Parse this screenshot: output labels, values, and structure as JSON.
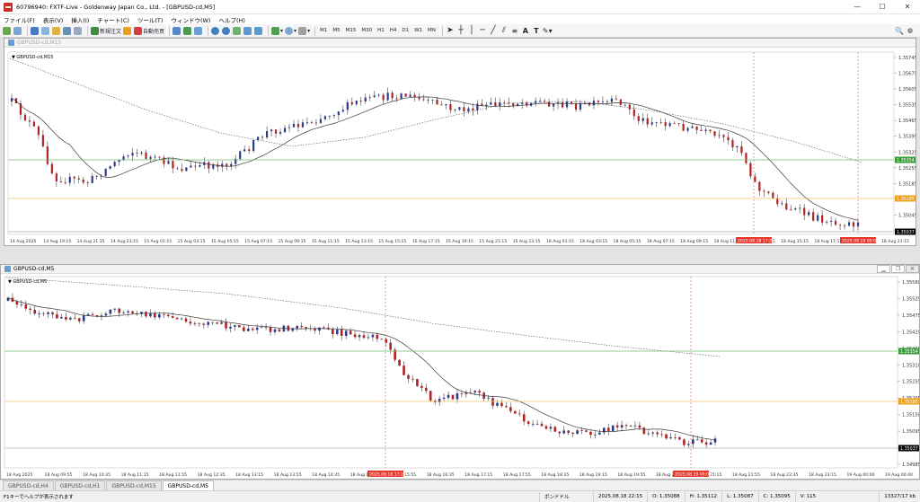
{
  "window": {
    "title": "60796940: FXTF-Live - Goldenway Japan Co., Ltd. - [GBPUSD-cd,M5]",
    "min": "—",
    "max": "☐",
    "close": "✕"
  },
  "menu": [
    "ファイル(F)",
    "表示(V)",
    "挿入(I)",
    "チャート(C)",
    "ツール(T)",
    "ウィンドウ(W)",
    "ヘルプ(H)"
  ],
  "toolbar": {
    "new_order": "新規注文",
    "auto_trade": "自動売買",
    "timeframes": [
      "M1",
      "M5",
      "M15",
      "M30",
      "H1",
      "H4",
      "D1",
      "W1",
      "MN"
    ]
  },
  "charts": {
    "top": {
      "window_title": "GBPUSD-cd,M15",
      "symbol_label": "GBPUSD-cd,M15",
      "price_ticks": [
        "1.35745",
        "1.35675",
        "1.35605",
        "1.35535",
        "1.35465",
        "1.35395",
        "1.35325",
        "1.35255",
        "1.35185",
        "1.35115",
        "1.35045",
        "1.34975"
      ],
      "time_ticks": [
        "14 Aug 2025",
        "14 Aug 19:15",
        "14 Aug 21:15",
        "14 Aug 23:15",
        "15 Aug 01:15",
        "15 Aug 03:15",
        "15 Aug 05:15",
        "15 Aug 07:15",
        "15 Aug 09:15",
        "15 Aug 11:15",
        "15 Aug 13:15",
        "15 Aug 15:15",
        "15 Aug 17:15",
        "15 Aug 19:15",
        "15 Aug 21:15",
        "15 Aug 23:15",
        "18 Aug 01:15",
        "18 Aug 03:15",
        "18 Aug 05:15",
        "18 Aug 07:15",
        "18 Aug 09:15",
        "18 Aug 11:15",
        "18 Aug 13:15",
        "18 Aug 15:15",
        "18 Aug 17:15",
        "18 Aug 19:15",
        "18 Aug 21:15"
      ],
      "hline_green": "1.35354",
      "hline_orange": "1.35185",
      "current_price": "1.35037",
      "vline_labels": [
        "2025.08.18 17:25",
        "2025.08.19 00:05"
      ]
    },
    "bottom": {
      "window_title": "GBPUSD-cd,M5",
      "symbol_label": "GBPUSD-cd,M5",
      "price_ticks": [
        "1.35580",
        "1.35525",
        "1.35475",
        "1.35420",
        "1.35365",
        "1.35310",
        "1.35255",
        "1.35205",
        "1.35150",
        "1.35095",
        "1.35040",
        "1.34985"
      ],
      "time_ticks": [
        "18 Aug 2025",
        "18 Aug 09:55",
        "18 Aug 10:35",
        "18 Aug 11:15",
        "18 Aug 11:55",
        "18 Aug 12:35",
        "18 Aug 13:15",
        "18 Aug 13:55",
        "18 Aug 14:35",
        "18 Aug 15:15",
        "18 Aug 15:55",
        "18 Aug 16:35",
        "18 Aug 17:15",
        "18 Aug 17:55",
        "18 Aug 18:35",
        "18 Aug 19:15",
        "18 Aug 19:55",
        "18 Aug 20:35",
        "18 Aug 21:15",
        "18 Aug 21:55",
        "18 Aug 22:35",
        "18 Aug 23:15",
        "19 Aug 00:00",
        "19 Aug 00:40"
      ],
      "hline_green": "1.35354",
      "hline_orange": "1.35185",
      "current_price": "1.35037",
      "vline_labels": [
        "2025.08.18 17:25",
        "2025.08.19 00:05"
      ]
    }
  },
  "tabs": [
    "GBPUSD-cd,H4",
    "GBPUSD-cd,H1",
    "GBPUSD-cd,M15",
    "GBPUSD-cd,M5"
  ],
  "status": {
    "help": "F1キーでヘルプが表示されます",
    "profile": "ボンドドル",
    "datetime": "2025.08.18 22:15",
    "open": "O: 1.35088",
    "high": "H: 1.35112",
    "low": "L: 1.35087",
    "close": "C: 1.35095",
    "volume": "V: 115",
    "traffic": "13327/17 kb"
  },
  "colors": {
    "bull": "#b22222",
    "bear": "#2b3a8c",
    "ma": "#3a3a3a",
    "green_line": "#6cbf6c",
    "orange_line": "#f0c060",
    "vline": "#e06060",
    "label_red": "#e8382c",
    "label_green": "#3a9a3a",
    "label_orange": "#f0a020"
  }
}
